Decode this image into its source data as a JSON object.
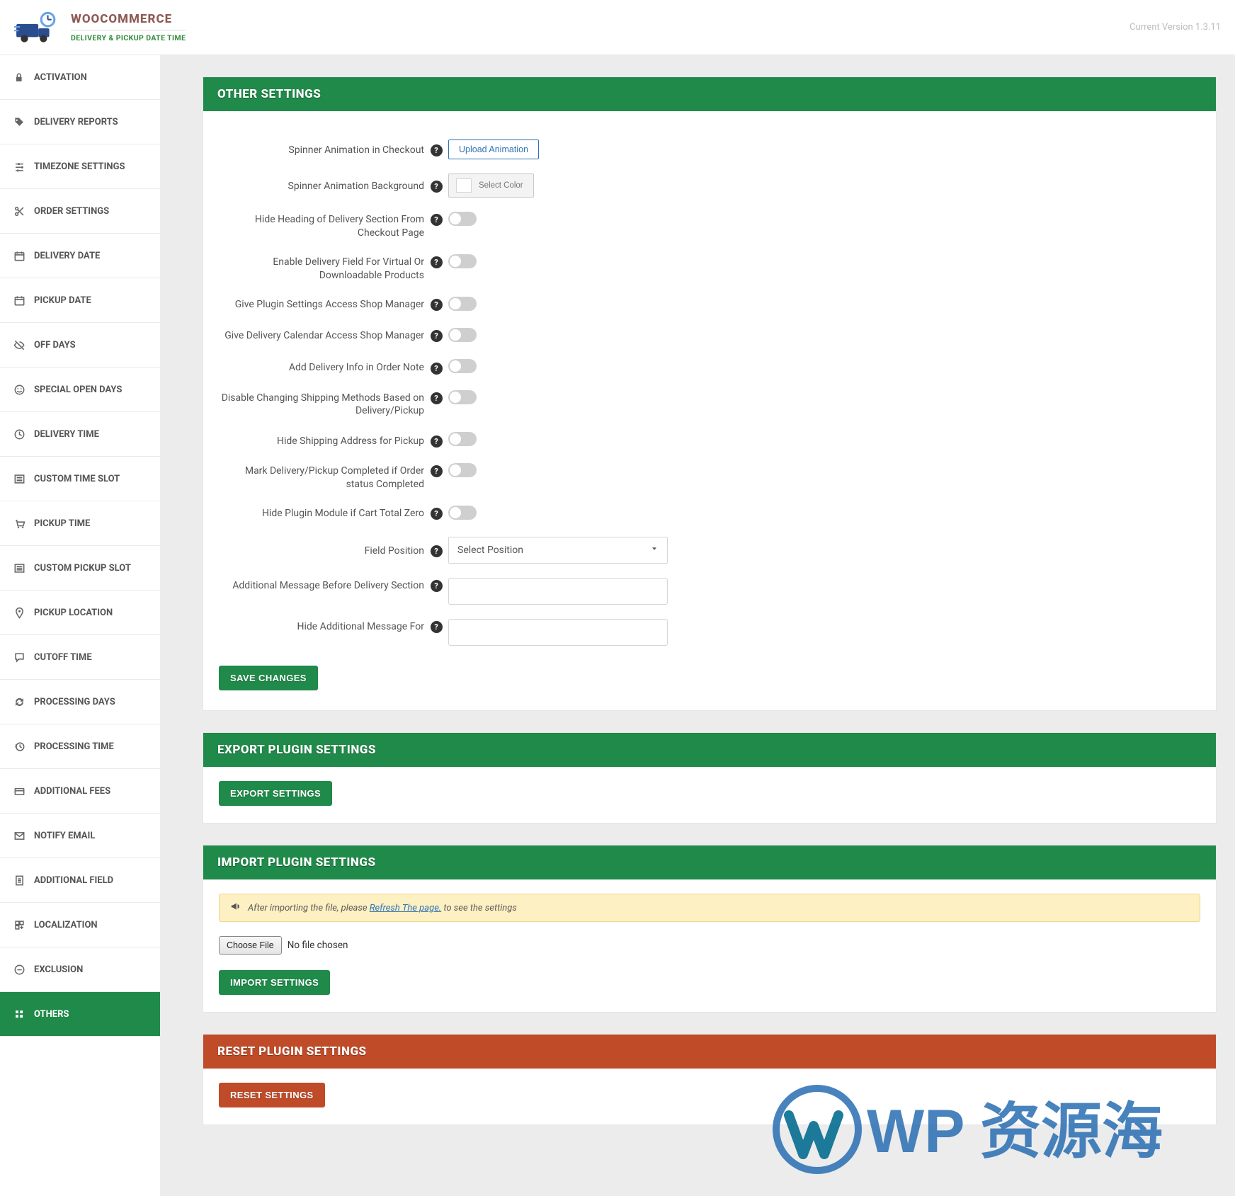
{
  "header": {
    "brand_title": "WOOCOMMERCE",
    "brand_sub": "DELIVERY & PICKUP DATE TIME",
    "version_label": "Current Version 1.3.11"
  },
  "sidebar": {
    "items": [
      {
        "label": "ACTIVATION",
        "icon": "lock",
        "active": false
      },
      {
        "label": "DELIVERY REPORTS",
        "icon": "tag",
        "active": false
      },
      {
        "label": "TIMEZONE SETTINGS",
        "icon": "sliders",
        "active": false
      },
      {
        "label": "ORDER SETTINGS",
        "icon": "scissors",
        "active": false
      },
      {
        "label": "DELIVERY DATE",
        "icon": "calendar",
        "active": false
      },
      {
        "label": "PICKUP DATE",
        "icon": "calendar",
        "active": false
      },
      {
        "label": "OFF DAYS",
        "icon": "eye-off",
        "active": false
      },
      {
        "label": "SPECIAL OPEN DAYS",
        "icon": "smile",
        "active": false
      },
      {
        "label": "DELIVERY TIME",
        "icon": "clock",
        "active": false
      },
      {
        "label": "CUSTOM TIME SLOT",
        "icon": "list",
        "active": false
      },
      {
        "label": "PICKUP TIME",
        "icon": "cart",
        "active": false
      },
      {
        "label": "CUSTOM PICKUP SLOT",
        "icon": "list",
        "active": false
      },
      {
        "label": "PICKUP LOCATION",
        "icon": "pin",
        "active": false
      },
      {
        "label": "CUTOFF TIME",
        "icon": "chat",
        "active": false
      },
      {
        "label": "PROCESSING DAYS",
        "icon": "refresh",
        "active": false
      },
      {
        "label": "PROCESSING TIME",
        "icon": "history",
        "active": false
      },
      {
        "label": "ADDITIONAL FEES",
        "icon": "card",
        "active": false
      },
      {
        "label": "NOTIFY EMAIL",
        "icon": "mail",
        "active": false
      },
      {
        "label": "ADDITIONAL FIELD",
        "icon": "doc",
        "active": false
      },
      {
        "label": "LOCALIZATION",
        "icon": "globe",
        "active": false
      },
      {
        "label": "EXCLUSION",
        "icon": "minus",
        "active": false
      },
      {
        "label": "OTHERS",
        "icon": "grid",
        "active": true
      }
    ]
  },
  "panels": {
    "other": {
      "title": "OTHER SETTINGS",
      "rows": [
        {
          "label": "Spinner Animation in Checkout",
          "ctrl": "upload",
          "button": "Upload Animation"
        },
        {
          "label": "Spinner Animation Background",
          "ctrl": "color",
          "button": "Select Color"
        },
        {
          "label": "Hide Heading of Delivery Section From Checkout Page",
          "ctrl": "toggle"
        },
        {
          "label": "Enable Delivery Field For Virtual Or Downloadable Products",
          "ctrl": "toggle"
        },
        {
          "label": "Give Plugin Settings Access Shop Manager",
          "ctrl": "toggle"
        },
        {
          "label": "Give Delivery Calendar Access Shop Manager",
          "ctrl": "toggle"
        },
        {
          "label": "Add Delivery Info in Order Note",
          "ctrl": "toggle"
        },
        {
          "label": "Disable Changing Shipping Methods Based on Delivery/Pickup",
          "ctrl": "toggle"
        },
        {
          "label": "Hide Shipping Address for Pickup",
          "ctrl": "toggle"
        },
        {
          "label": "Mark Delivery/Pickup Completed if Order status Completed",
          "ctrl": "toggle"
        },
        {
          "label": "Hide Plugin Module if Cart Total Zero",
          "ctrl": "toggle"
        },
        {
          "label": "Field Position",
          "ctrl": "select",
          "placeholder": "Select Position"
        },
        {
          "label": "Additional Message Before Delivery Section",
          "ctrl": "text"
        },
        {
          "label": "Hide Additional Message For",
          "ctrl": "text"
        }
      ],
      "save": "SAVE CHANGES"
    },
    "export": {
      "title": "EXPORT PLUGIN SETTINGS",
      "button": "EXPORT SETTINGS"
    },
    "import": {
      "title": "IMPORT PLUGIN SETTINGS",
      "notice_prefix": "After importing the file, please ",
      "notice_link": "Refresh The page.",
      "notice_suffix": " to see the settings",
      "choose": "Choose File",
      "nofile": "No file chosen",
      "button": "IMPORT SETTINGS"
    },
    "reset": {
      "title": "RESET PLUGIN SETTINGS",
      "button": "RESET SETTINGS"
    }
  },
  "watermark": "WP 资源海"
}
